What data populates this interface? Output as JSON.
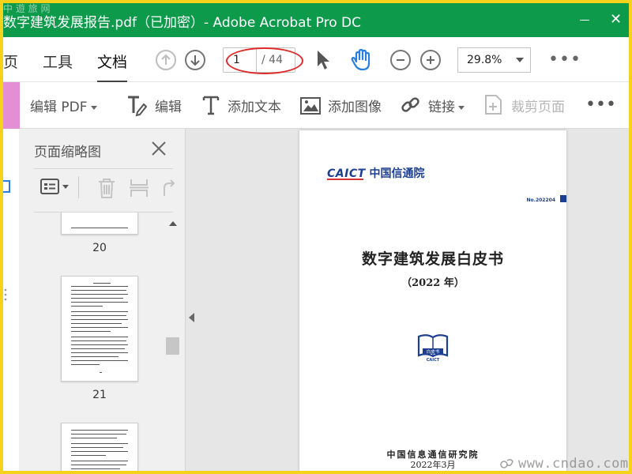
{
  "window": {
    "title": "数字建筑发展报告.pdf（已加密）- Adobe Acrobat Pro DC",
    "corner_watermark": "中 遊 旅 网",
    "close_label": "✕"
  },
  "nav": {
    "tabs": [
      {
        "label": "页",
        "active": false
      },
      {
        "label": "工具",
        "active": false
      },
      {
        "label": "文档",
        "active": true
      }
    ]
  },
  "pager": {
    "current_page": "1",
    "total_label": "/ 44"
  },
  "zoom": {
    "value": "29.8%"
  },
  "more_label": "•••",
  "edit_toolbar": {
    "edit_pdf_label": "编辑 PDF",
    "edit_label": "编辑",
    "add_text_label": "添加文本",
    "add_image_label": "添加图像",
    "link_label": "链接",
    "crop_label": "裁剪页面"
  },
  "thumbnails_panel": {
    "title": "页面缩略图",
    "pages": [
      {
        "number": "20"
      },
      {
        "number": "21"
      }
    ]
  },
  "document": {
    "logo_caict": "CAICT",
    "logo_cn": "中国信通院",
    "doc_number": "No.202204",
    "title": "数字建筑发展白皮书",
    "year": "（2022 年）",
    "emblem_label": "白皮书",
    "emblem_sub": "CAICT",
    "organization": "中国信息通信研究院",
    "date": "2022年3月"
  },
  "site_watermark": "www.cndao.com",
  "colors": {
    "titlebar": "#0e9a4b",
    "frame": "#f5d21c",
    "accent_blue": "#1d3f91",
    "annotation_red": "#e02a2a",
    "hand_tool": "#2a7de1"
  }
}
